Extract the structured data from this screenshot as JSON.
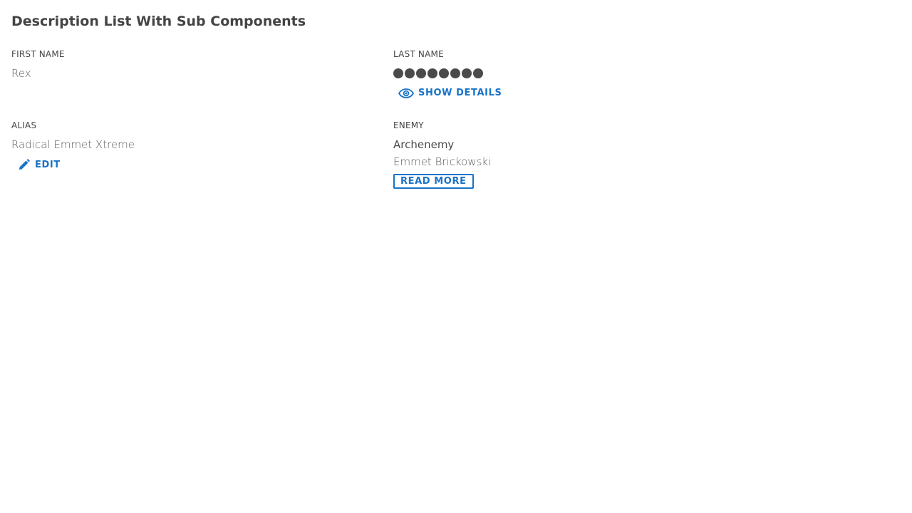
{
  "page": {
    "title": "Description List With Sub Components"
  },
  "items": {
    "first_name": {
      "label": "FIRST NAME",
      "value": "Rex"
    },
    "last_name": {
      "label": "LAST NAME",
      "masked_char_count": 8,
      "action_label": "SHOW DETAILS",
      "action_icon": "eye-icon"
    },
    "alias": {
      "label": "ALIAS",
      "value": "Radical Emmet Xtreme",
      "action_label": "EDIT",
      "action_icon": "pencil-icon"
    },
    "enemy": {
      "label": "ENEMY",
      "subheading": "Archenemy",
      "value": "Emmet Brickowski",
      "action_label": "READ MORE"
    }
  },
  "colors": {
    "accent": "#1a73c8",
    "text": "#4a4a4a"
  }
}
